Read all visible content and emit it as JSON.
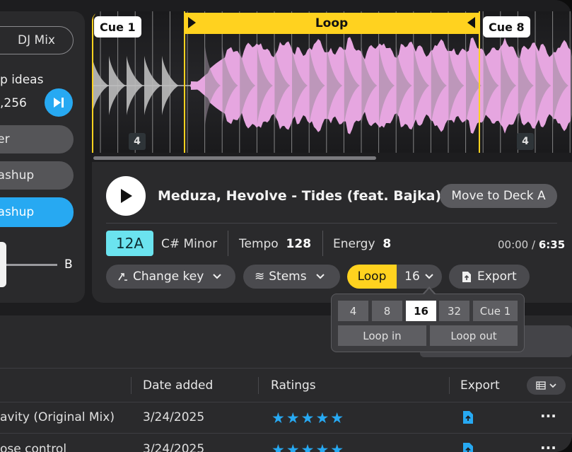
{
  "sidebar": {
    "dj_mix": "DJ Mix",
    "ideas_label": "p ideas",
    "ideas_count": ",256",
    "filter_label": "ilter",
    "mashup_label": "mashup",
    "mashup_active_label": "mashup",
    "crossfader_b": "B"
  },
  "waveform": {
    "cue_start": "Cue 1",
    "cue_end": "Cue 8",
    "loop_label": "Loop",
    "beat_left": "4",
    "beat_right": "4"
  },
  "deck": {
    "track_title": "Meduza, Hevolve - Tides (feat. Bajka)",
    "move_button": "Move to Deck A",
    "key_code": "12A",
    "key_name": "C# Minor",
    "tempo_label": "Tempo",
    "tempo_value": "128",
    "energy_label": "Energy",
    "energy_value": "8",
    "time_current": "00:00",
    "time_sep": " / ",
    "time_total": "6:35",
    "change_key": "Change key",
    "stems": "Stems",
    "loop": "Loop",
    "loop_size": "16",
    "export": "Export"
  },
  "loop_popover": {
    "sizes": [
      "4",
      "8",
      "16",
      "32"
    ],
    "selected": "16",
    "cue": "Cue 1",
    "loop_in": "Loop in",
    "loop_out": "Loop out"
  },
  "table": {
    "columns": [
      "Date added",
      "Ratings",
      "Export"
    ],
    "rows": [
      {
        "title": "avity (Original Mix)",
        "date": "3/24/2025",
        "rating": 5
      },
      {
        "title": "ose control",
        "date": "3/24/2025",
        "rating": 5
      }
    ]
  },
  "colors": {
    "accent_blue": "#27a9f2",
    "loop_yellow": "#ffd21f",
    "key_cyan": "#6be3ef",
    "waveform_pink": "#e6a6e0"
  }
}
